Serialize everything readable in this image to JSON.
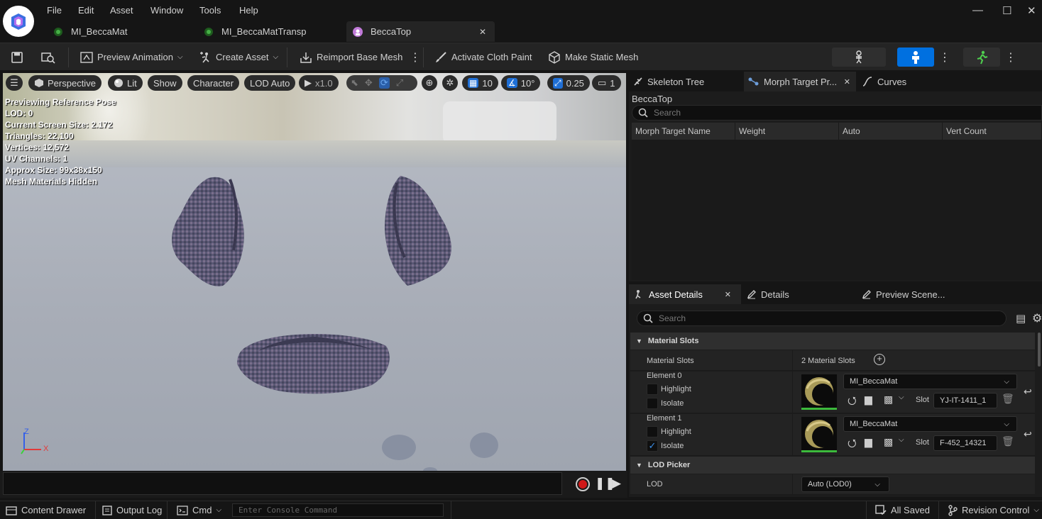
{
  "menu": [
    "File",
    "Edit",
    "Asset",
    "Window",
    "Tools",
    "Help"
  ],
  "tabs": [
    {
      "label": "MI_BeccaMat",
      "active": false
    },
    {
      "label": "MI_BeccaMatTransp",
      "active": false
    },
    {
      "label": "BeccaTop",
      "active": true
    }
  ],
  "window_controls": {
    "minimize": "—",
    "maximize": "☐",
    "close": "✕"
  },
  "toolbar": {
    "preview_animation": "Preview Animation",
    "create_asset": "Create Asset",
    "reimport": "Reimport Base Mesh",
    "cloth_paint": "Activate Cloth Paint",
    "static_mesh": "Make Static Mesh"
  },
  "viewport": {
    "perspective": "Perspective",
    "lit": "Lit",
    "show": "Show",
    "character": "Character",
    "lod": "LOD Auto",
    "speed": "x1.0",
    "grid": "10",
    "angle": "10°",
    "scale": "0.25",
    "camera": "1",
    "stats": [
      "Previewing Reference Pose",
      "LOD: 0",
      "Current Screen Size: 2.172",
      "Triangles: 22,100",
      "Vertices: 12,572",
      "UV Channels: 1",
      "Approx Size: 99x38x150",
      "Mesh Materials Hidden"
    ],
    "axis": {
      "z": "Z",
      "x": "X"
    }
  },
  "top_panel": {
    "tabs": [
      "Skeleton Tree",
      "Morph Target Pr...",
      "Curves"
    ],
    "asset_name": "BeccaTop",
    "search_placeholder": "Search",
    "columns": [
      "Morph Target Name",
      "Weight",
      "Auto",
      "Vert Count"
    ]
  },
  "details_panel": {
    "tabs": [
      "Asset Details",
      "Details",
      "Preview Scene..."
    ],
    "search_placeholder": "Search",
    "sections": {
      "material_slots": "Material Slots",
      "lod_picker": "LOD Picker"
    },
    "material_slots_label": "Material Slots",
    "material_slots_count": "2 Material Slots",
    "elements": [
      {
        "label": "Element 0",
        "highlight": "Highlight",
        "isolate": "Isolate",
        "highlight_checked": false,
        "isolate_checked": false,
        "material": "MI_BeccaMat",
        "slot_label": "Slot",
        "slot_value": "YJ-IT-1411_1"
      },
      {
        "label": "Element 1",
        "highlight": "Highlight",
        "isolate": "Isolate",
        "highlight_checked": false,
        "isolate_checked": true,
        "material": "MI_BeccaMat",
        "slot_label": "Slot",
        "slot_value": "F-452_14321"
      }
    ],
    "lod_label": "LOD",
    "lod_value": "Auto (LOD0)"
  },
  "statusbar": {
    "content_drawer": "Content Drawer",
    "output_log": "Output Log",
    "cmd": "Cmd",
    "console_placeholder": "Enter Console Command",
    "saved": "All Saved",
    "revision": "Revision Control"
  },
  "colors": {
    "accent": "#1f6fd6",
    "mode_active": "#0070e0",
    "check": "#3a8ee6",
    "material_thumb_bar": "#3cba3c"
  }
}
